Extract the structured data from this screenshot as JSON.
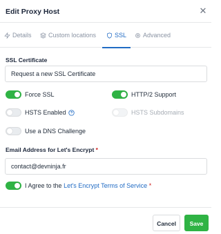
{
  "dialog": {
    "title": "Edit Proxy Host"
  },
  "tabs": [
    {
      "label": "Details",
      "icon": "zap-icon"
    },
    {
      "label": "Custom locations",
      "icon": "layers-icon"
    },
    {
      "label": "SSL",
      "icon": "shield-icon",
      "active": true
    },
    {
      "label": "Advanced",
      "icon": "gear-icon"
    }
  ],
  "ssl": {
    "certificate_label": "SSL Certificate",
    "certificate_value": "Request a new SSL Certificate",
    "force_ssl": {
      "label": "Force SSL",
      "on": true
    },
    "http2": {
      "label": "HTTP/2 Support",
      "on": true
    },
    "hsts_enabled": {
      "label": "HSTS Enabled",
      "on": false
    },
    "hsts_subdomains": {
      "label": "HSTS Subdomains",
      "on": false,
      "disabled": true
    },
    "dns_challenge": {
      "label": "Use a DNS Challenge",
      "on": false
    },
    "email_label": "Email Address for Let's Encrypt",
    "email_required": "*",
    "email_value": "contact@devninja.fr",
    "agree": {
      "prefix": "I Agree to the",
      "link": "Let's Encrypt Terms of Service",
      "required": "*",
      "on": true
    }
  },
  "footer": {
    "cancel_label": "Cancel",
    "save_label": "Save"
  },
  "colors": {
    "primary": "#206bc4",
    "success": "#2fb344",
    "danger": "#cd201f"
  }
}
